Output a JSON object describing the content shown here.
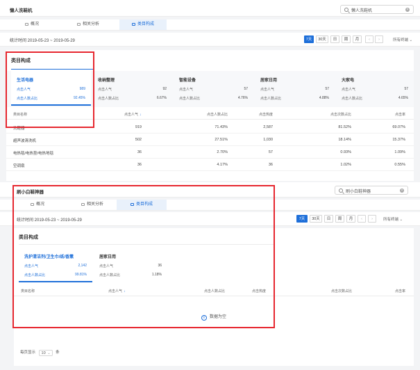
{
  "tab_names": [
    "概况",
    "相关分析",
    "类目构成"
  ],
  "top": {
    "title": "懒人洗鞋机",
    "search_value": "懒人洗鞋机",
    "date_range": "统计时间 2019-05-23 ~ 2019-05-29",
    "periods": [
      "7天",
      "30天",
      "日",
      "周",
      "月"
    ],
    "terminal": "所有终端",
    "section_title": "类目构成",
    "metric_pop": "点击人气",
    "metric_ratio": "点击人数占比",
    "cards": [
      {
        "name": "生活电器",
        "pop": "989",
        "ratio": "92.45%"
      },
      {
        "name": "收纳整理",
        "pop": "92",
        "ratio": "6.67%"
      },
      {
        "name": "智能设备",
        "pop": "57",
        "ratio": "4.76%"
      },
      {
        "name": "居家日用",
        "pop": "57",
        "ratio": "4.88%"
      },
      {
        "name": "大家电",
        "pop": "57",
        "ratio": "4.65%"
      }
    ],
    "columns": [
      "类目名称",
      "点击人气",
      "点击人数占比",
      "点击热度",
      "点击次数占比",
      "点击率"
    ],
    "rows": [
      [
        "洗鞋器",
        "919",
        "71.43%",
        "2,587",
        "81.52%",
        "69.07%"
      ],
      [
        "超声波清洗机",
        "502",
        "27.51%",
        "1,030",
        "18.14%",
        "15.37%"
      ],
      [
        "电热毯/电热垫/电热地毯",
        "36",
        "2.70%",
        "57",
        "0.93%",
        "1.09%"
      ],
      [
        "空调扇",
        "36",
        "4.17%",
        "36",
        "1.02%",
        "0.55%"
      ]
    ]
  },
  "bottom": {
    "title": "刷小白鞋神器",
    "search_value": "刷小白鞋神器",
    "date_range": "统计时间 2019-05-23 ~ 2019-05-29",
    "periods": [
      "7天",
      "30天",
      "日",
      "周",
      "月"
    ],
    "terminal": "所有终端",
    "section_title": "类目构成",
    "metric_pop": "点击人气",
    "metric_ratio": "点击人数占比",
    "cards": [
      {
        "name": "洗护清洁剂/卫生巾/纸/香薰",
        "pop": "2,142",
        "ratio": "99.81%"
      },
      {
        "name": "居家日用",
        "pop": "36",
        "ratio": "1.18%"
      }
    ],
    "columns": [
      "类目名称",
      "点击人气",
      "点击人数占比",
      "点击热度",
      "点击次数占比",
      "点击率"
    ],
    "empty_text": "数据为空",
    "page_size_label_pre": "每页显示",
    "page_size": "10",
    "page_size_label_post": "条"
  },
  "colors": {
    "accent": "#1e6fd9",
    "highlight": "#e6262e"
  }
}
